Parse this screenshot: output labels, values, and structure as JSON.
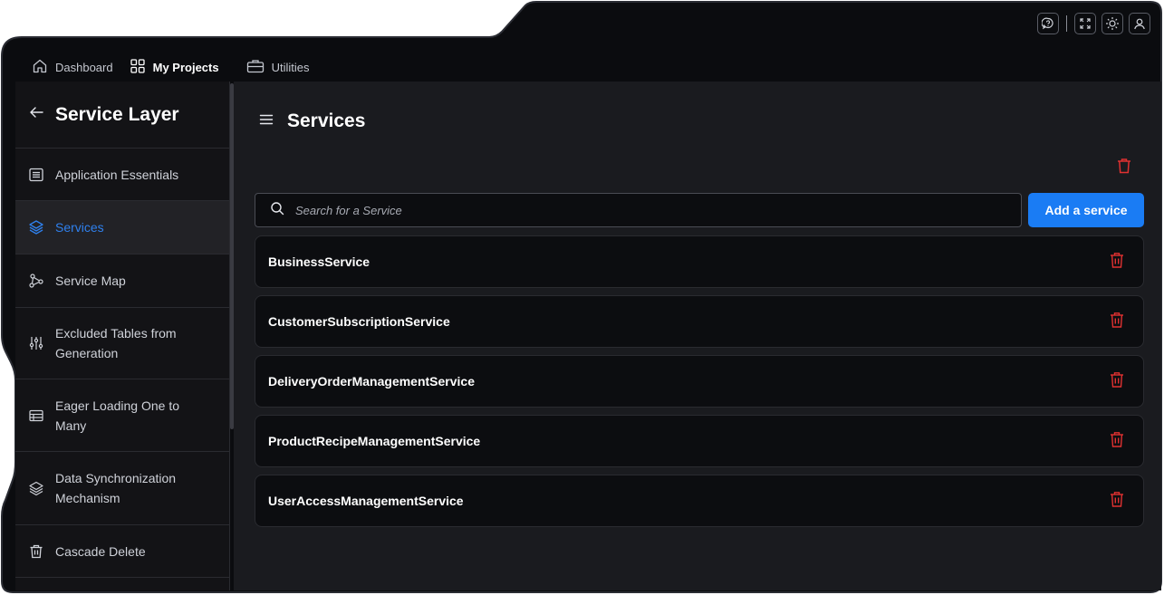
{
  "nav": {
    "tabs": [
      {
        "label": "Dashboard",
        "icon": "home-icon"
      },
      {
        "label": "My Projects",
        "icon": "grid-icon",
        "active": true
      },
      {
        "label": "Utilities",
        "icon": "briefcase-icon"
      }
    ]
  },
  "toolbar": {
    "icons": [
      "help-icon",
      "fullscreen-icon",
      "theme-icon",
      "user-icon"
    ]
  },
  "sidebar": {
    "title": "Service Layer",
    "items": [
      {
        "label": "Application Essentials",
        "icon": "list-icon"
      },
      {
        "label": "Services",
        "icon": "layers-icon",
        "active": true
      },
      {
        "label": "Service Map",
        "icon": "graph-icon"
      },
      {
        "label": "Excluded Tables from Generation",
        "icon": "sliders-icon"
      },
      {
        "label": "Eager Loading One to Many",
        "icon": "table-icon"
      },
      {
        "label": "Data Synchronization Mechanism",
        "icon": "stack-icon"
      },
      {
        "label": "Cascade Delete",
        "icon": "trash-icon"
      }
    ]
  },
  "main": {
    "title": "Services",
    "search_placeholder": "Search for a Service",
    "add_button": "Add a service",
    "services": [
      "BusinessService",
      "CustomerSubscriptionService",
      "DeliveryOrderManagementService",
      "ProductRecipeManagementService",
      "UserAccessManagementService"
    ]
  },
  "colors": {
    "accent": "#1a7cf4",
    "danger": "#e03131",
    "background": "#1a1b1f",
    "panel": "#131316"
  }
}
